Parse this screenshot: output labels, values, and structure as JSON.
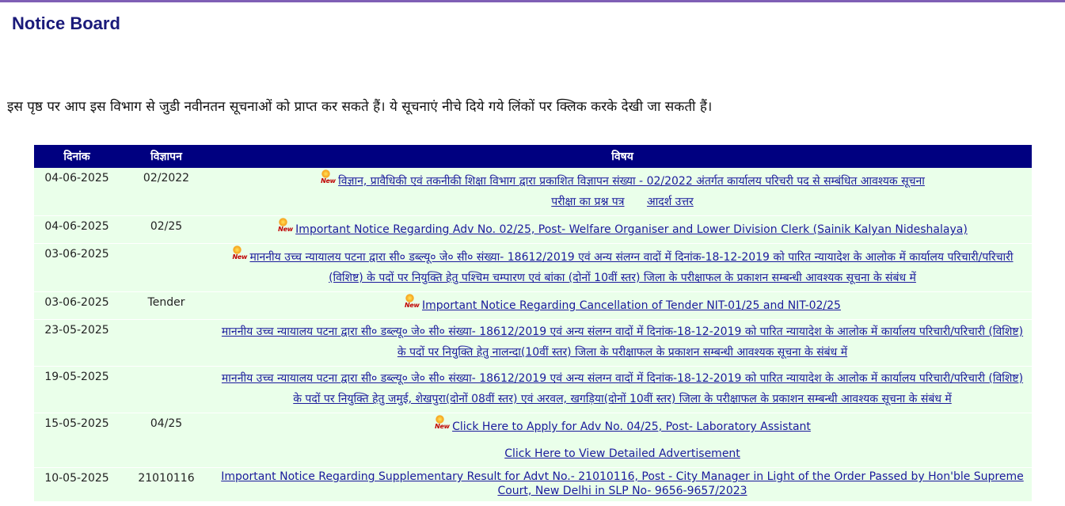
{
  "page": {
    "title": "Notice Board",
    "intro": "इस पृष्ठ पर आप इस विभाग से जुडी नवीनतन सूचनाओं को प्राप्त कर सकते हैं। ये सूचनाएं नीचे दिये गये लिंकों पर क्लिक करके देखी जा सकती हैं।",
    "accent_color": "#000080",
    "row_bg": "#eaffea",
    "new_badge_label": "New"
  },
  "table": {
    "headers": [
      "दिनांक",
      "विज्ञापन",
      "विषय"
    ],
    "rows": [
      {
        "date": "04-06-2025",
        "adv": "02/2022",
        "new": true,
        "subject": "विज्ञान, प्रावैधिकी एवं तकनीकी शिक्षा विभाग द्वारा प्रकाशित विज्ञापन संख्या - 02/2022 अंतर्गत कार्यालय परिचरी पद से सम्बंधित आवश्यक सूचना",
        "extra_links": [
          "परीक्षा का प्रश्न पत्र",
          "आदर्श उत्तर"
        ]
      },
      {
        "date": "04-06-2025",
        "adv": "02/25",
        "new": true,
        "subject": "Important Notice Regarding Adv No. 02/25, Post- Welfare Organiser and Lower Division Clerk (Sainik Kalyan Nideshalaya)"
      },
      {
        "date": "03-06-2025",
        "adv": "",
        "new": true,
        "subject": "माननीय उच्च न्यायालय पटना द्वारा सी० डब्ल्यू० जे० सी० संख्या- 18612/2019 एवं अन्य संलग्न वादों में दिनांक-18-12-2019 को पारित न्यायादेश के आलोक में कार्यालय परिचारी/परिचारी (विशिष्ट) के पदों पर नियुक्ति हेतु पश्चिम चम्पारण एवं बांका (दोनों 10वीं स्तर) जिला के परीक्षाफल के प्रकाशन सम्बन्धी आवश्यक सूचना के संबंध में"
      },
      {
        "date": "03-06-2025",
        "adv": "Tender",
        "new": true,
        "subject": "Important Notice Regarding Cancellation of Tender NIT-01/25 and NIT-02/25"
      },
      {
        "date": "23-05-2025",
        "adv": "",
        "new": false,
        "subject": "माननीय उच्च न्यायालय पटना द्वारा सी० डब्ल्यू० जे० सी० संख्या- 18612/2019 एवं अन्य संलग्न वादों में दिनांक-18-12-2019 को पारित न्यायादेश के आलोक में कार्यालय परिचारी/परिचारी (विशिष्ट) के पदों पर नियुक्ति हेतु नालन्दा(10वीं स्तर) जिला के परीक्षाफल के प्रकाशन सम्बन्धी आवश्यक सूचना के संबंध में"
      },
      {
        "date": "19-05-2025",
        "adv": "",
        "new": false,
        "subject": "माननीय उच्च न्यायालय पटना द्वारा सी० डब्ल्यू० जे० सी० संख्या- 18612/2019 एवं अन्य संलग्न वादों में दिनांक-18-12-2019 को पारित न्यायादेश के आलोक में कार्यालय परिचारी/परिचारी (विशिष्ट) के पदों पर नियुक्ति हेतु जमुई, शेखपुरा(दोनों 08वीं स्तर) एवं अरवल, खगड़िया(दोनों 10वीं स्तर) जिला के परीक्षाफल के प्रकाशन सम्बन्धी आवश्यक सूचना के संबंध में"
      },
      {
        "date": "15-05-2025",
        "adv": "04/25",
        "new": true,
        "subject": "Click Here to Apply for Adv No. 04/25, Post- Laboratory Assistant",
        "second_link": "Click Here to View Detailed Advertisement"
      },
      {
        "date": "10-05-2025",
        "adv": "21010116",
        "new": false,
        "subject": "Important Notice Regarding Supplementary Result for Advt No.- 21010116, Post - City Manager in Light of the Order Passed by Hon'ble Supreme Court, New Delhi in SLP No- 9656-9657/2023"
      }
    ]
  }
}
